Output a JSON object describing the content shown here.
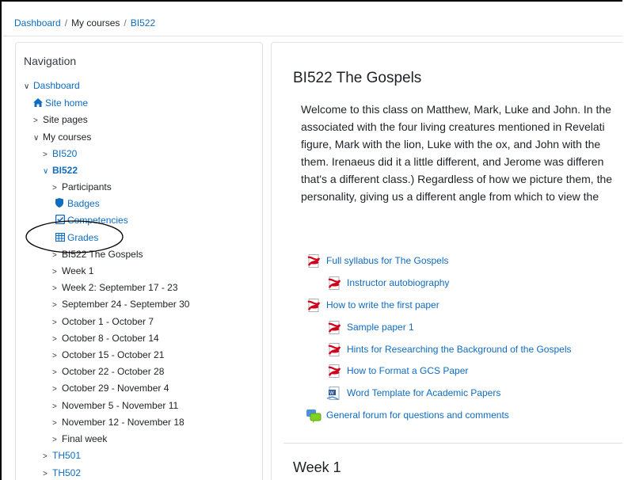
{
  "breadcrumb": [
    "Dashboard",
    "My courses",
    "BI522"
  ],
  "nav": {
    "title": "Navigation",
    "items": [
      {
        "label": "Dashboard"
      },
      {
        "label": "Site home"
      },
      {
        "label": "Site pages"
      },
      {
        "label": "My courses"
      },
      {
        "label": "BI520"
      },
      {
        "label": "BI522"
      },
      {
        "label": "Participants"
      },
      {
        "label": "Badges"
      },
      {
        "label": "Competencies"
      },
      {
        "label": "Grades"
      },
      {
        "label": "BI522 The Gospels"
      },
      {
        "label": "Week 1"
      },
      {
        "label": "Week 2: September 17 - 23"
      },
      {
        "label": "September 24 - September 30"
      },
      {
        "label": "October 1 - October 7"
      },
      {
        "label": "October 8 - October 14"
      },
      {
        "label": "October 15 - October 21"
      },
      {
        "label": "October 22 - October 28"
      },
      {
        "label": "October 29 - November 4"
      },
      {
        "label": "November 5 - November 11"
      },
      {
        "label": "November 12 - November 18"
      },
      {
        "label": "Final week"
      },
      {
        "label": "TH501"
      },
      {
        "label": "TH502"
      }
    ]
  },
  "course": {
    "title": "BI522 The Gospels",
    "summary_lines": [
      "Welcome to this class on Matthew, Mark, Luke and John. In the",
      "associated with the four living creatures mentioned in Revelati",
      "figure, Mark with the lion, Luke with the ox, and John with the",
      "them. Irenaeus did it a little different, and Jerome was differen",
      "that's a different class.) Regardless of how we picture them, the",
      "personality, giving us a different angle from which to view the"
    ],
    "activities": [
      {
        "name": "Full syllabus for The Gospels",
        "icon": "pdf-icon"
      },
      {
        "name": "Instructor autobiography",
        "icon": "pdf-icon"
      },
      {
        "name": "How to write the first paper",
        "icon": "pdf-icon"
      },
      {
        "name": "Sample paper 1",
        "icon": "pdf-icon"
      },
      {
        "name": "Hints for Researching the Background of the Gospels",
        "icon": "pdf-icon"
      },
      {
        "name": "How to Format a GCS Paper",
        "icon": "pdf-icon"
      },
      {
        "name": "Word Template for Academic Papers",
        "icon": "word-icon"
      },
      {
        "name": "General forum for questions and comments",
        "icon": "forum-icon"
      }
    ],
    "next_section": "Week 1"
  },
  "colors": {
    "link": "#0f6cbf",
    "pdf_red": "#d0021b",
    "annotation": "#000000"
  }
}
